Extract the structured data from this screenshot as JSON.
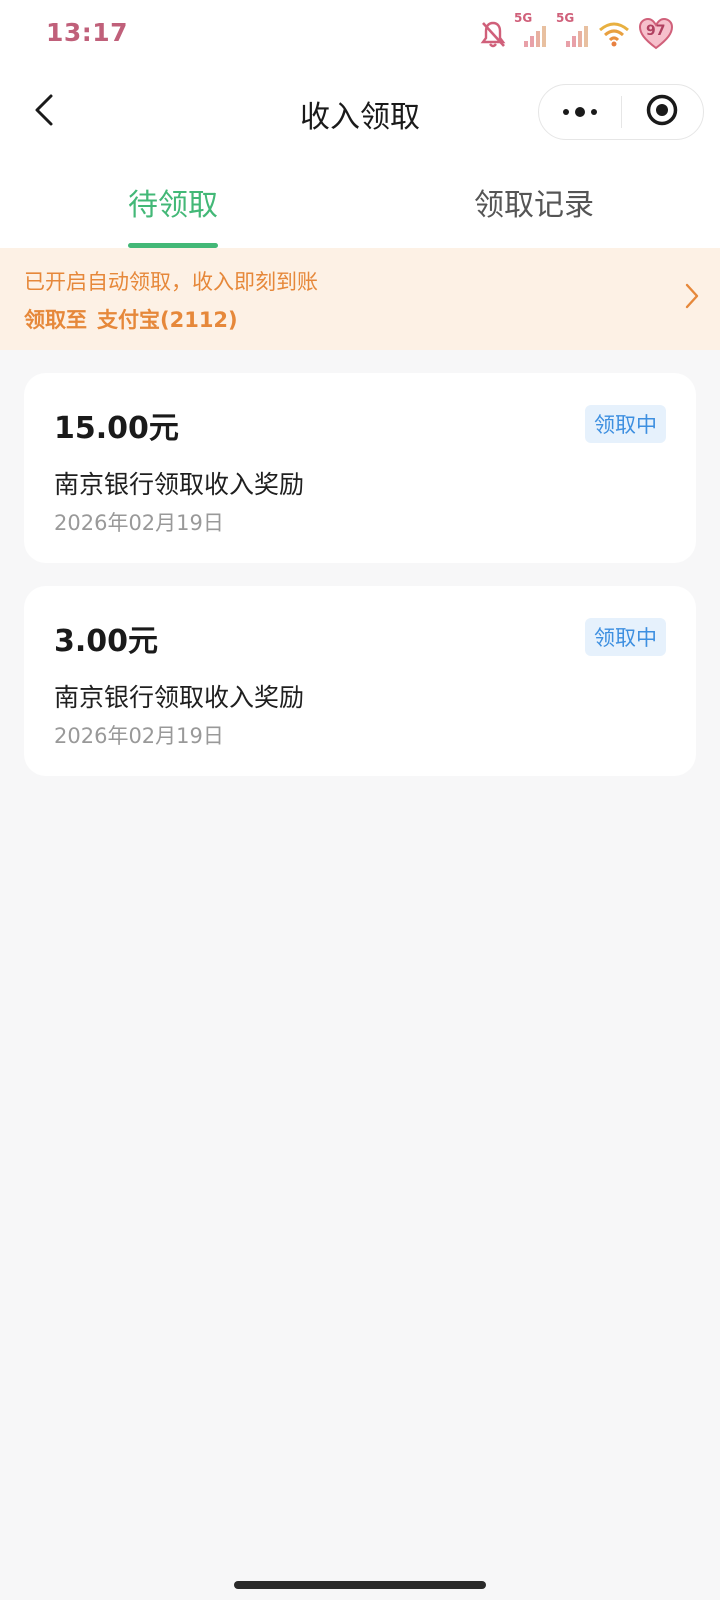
{
  "status_bar": {
    "time": "13:17",
    "signal_1_label": "5G",
    "signal_2_label": "5G",
    "battery_level": "97",
    "icons": [
      "bell-muted-icon",
      "signal-icon",
      "signal-icon",
      "wifi-icon",
      "battery-heart-icon"
    ],
    "time_color": "#c0607a"
  },
  "nav": {
    "title": "收入领取",
    "back_icon": "chevron-left-icon",
    "more_icon": "more-dots-icon",
    "close_icon": "target-circle-icon"
  },
  "tabs": [
    {
      "label": "待领取",
      "active": true
    },
    {
      "label": "领取记录",
      "active": false
    }
  ],
  "banner": {
    "line1": "已开启自动领取，收入即刻到账",
    "line2_prefix": "领取至",
    "line2_account": "支付宝(2112)",
    "chevron_icon": "chevron-right-icon",
    "text_color": "#e6883a",
    "background": "#fdf1e5"
  },
  "records": [
    {
      "amount": "15.00元",
      "status": "领取中",
      "description": "南京银行领取收入奖励",
      "date": "2026年02月19日"
    },
    {
      "amount": "3.00元",
      "status": "领取中",
      "description": "南京银行领取收入奖励",
      "date": "2026年02月19日"
    }
  ],
  "colors": {
    "accent": "#43b877",
    "status_text": "#3d8fe0",
    "status_bg": "#e6f1fc",
    "page_bg": "#f7f7f8"
  }
}
